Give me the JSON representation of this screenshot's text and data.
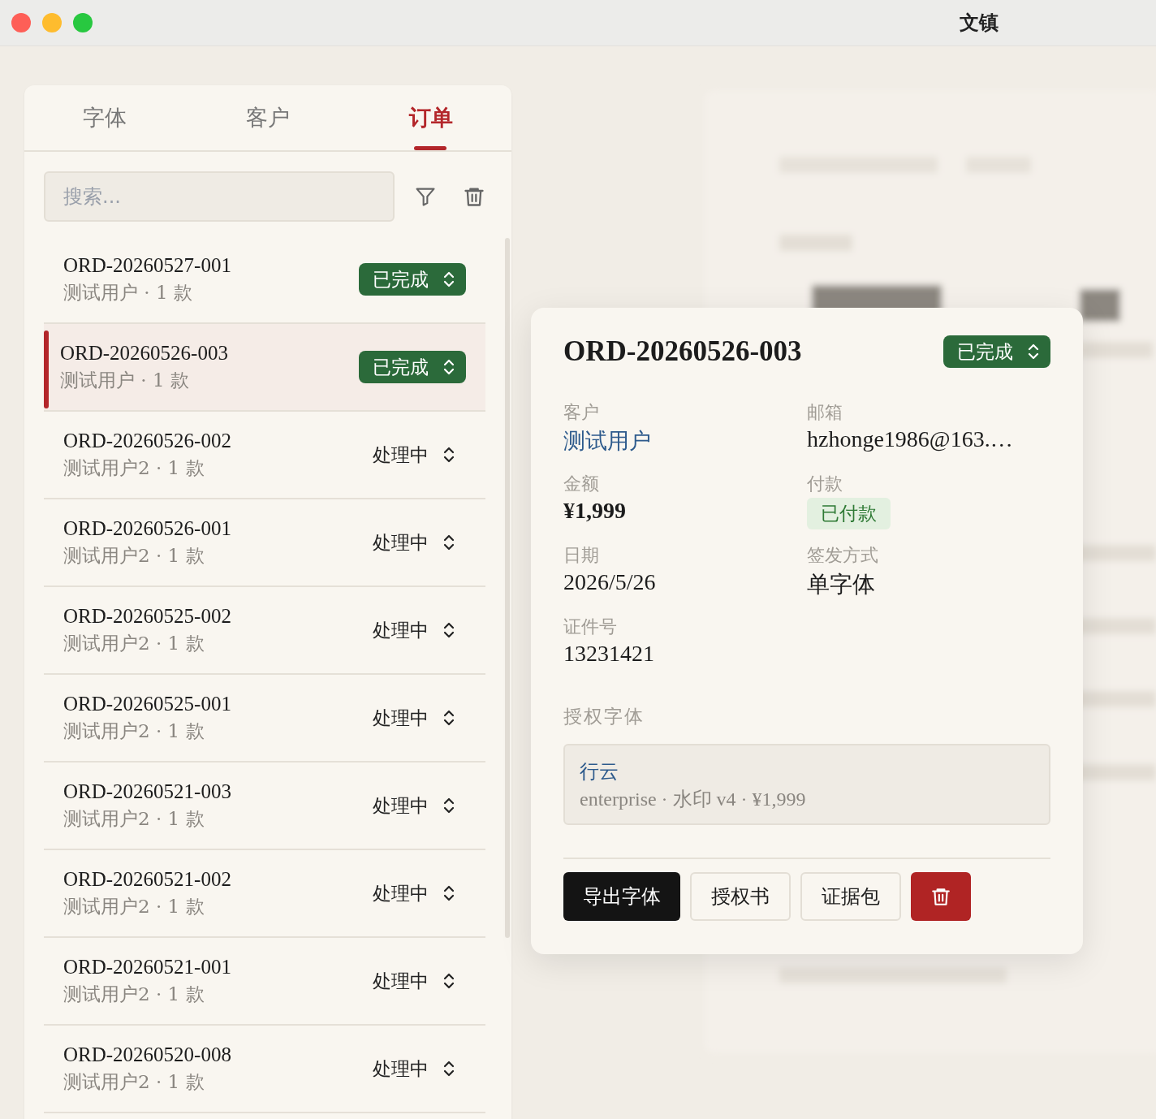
{
  "window": {
    "title": "文镇"
  },
  "tabs": [
    {
      "label": "字体",
      "selected": false
    },
    {
      "label": "客户",
      "selected": false
    },
    {
      "label": "订单",
      "selected": true
    }
  ],
  "search": {
    "placeholder": "搜索..."
  },
  "orders": [
    {
      "id": "ORD-20260527-001",
      "meta": "测试用户 · 1 款",
      "status": {
        "label": "已完成",
        "kind": "done"
      },
      "selected": false
    },
    {
      "id": "ORD-20260526-003",
      "meta": "测试用户 · 1 款",
      "status": {
        "label": "已完成",
        "kind": "done"
      },
      "selected": true
    },
    {
      "id": "ORD-20260526-002",
      "meta": "测试用户2 · 1 款",
      "status": {
        "label": "处理中",
        "kind": "processing"
      },
      "selected": false
    },
    {
      "id": "ORD-20260526-001",
      "meta": "测试用户2 · 1 款",
      "status": {
        "label": "处理中",
        "kind": "processing"
      },
      "selected": false
    },
    {
      "id": "ORD-20260525-002",
      "meta": "测试用户2 · 1 款",
      "status": {
        "label": "处理中",
        "kind": "processing"
      },
      "selected": false
    },
    {
      "id": "ORD-20260525-001",
      "meta": "测试用户2 · 1 款",
      "status": {
        "label": "处理中",
        "kind": "processing"
      },
      "selected": false
    },
    {
      "id": "ORD-20260521-003",
      "meta": "测试用户2 · 1 款",
      "status": {
        "label": "处理中",
        "kind": "processing"
      },
      "selected": false
    },
    {
      "id": "ORD-20260521-002",
      "meta": "测试用户2 · 1 款",
      "status": {
        "label": "处理中",
        "kind": "processing"
      },
      "selected": false
    },
    {
      "id": "ORD-20260521-001",
      "meta": "测试用户2 · 1 款",
      "status": {
        "label": "处理中",
        "kind": "processing"
      },
      "selected": false
    },
    {
      "id": "ORD-20260520-008",
      "meta": "测试用户2 · 1 款",
      "status": {
        "label": "处理中",
        "kind": "processing"
      },
      "selected": false
    }
  ],
  "detail": {
    "title": "ORD-20260526-003",
    "status": {
      "label": "已完成",
      "kind": "done"
    },
    "fields": [
      {
        "label": "客户",
        "value": "测试用户",
        "kind": "link"
      },
      {
        "label": "邮箱",
        "value": "hzhonge1986@163.…",
        "kind": "text"
      },
      {
        "label": "金额",
        "value": "¥1,999",
        "kind": "bold"
      },
      {
        "label": "付款",
        "value": "已付款",
        "kind": "badge"
      },
      {
        "label": "日期",
        "value": "2026/5/26",
        "kind": "text"
      },
      {
        "label": "签发方式",
        "value": "单字体",
        "kind": "text"
      },
      {
        "label": "证件号",
        "value": "13231421",
        "kind": "text"
      }
    ],
    "fonts_heading": "授权字体",
    "fonts": [
      {
        "name": "行云",
        "meta": "enterprise · 水印 v4 · ¥1,999"
      }
    ],
    "actions": [
      {
        "label": "导出字体",
        "kind": "primary"
      },
      {
        "label": "授权书",
        "kind": "outline"
      },
      {
        "label": "证据包",
        "kind": "outline"
      },
      {
        "kind": "danger"
      }
    ]
  }
}
